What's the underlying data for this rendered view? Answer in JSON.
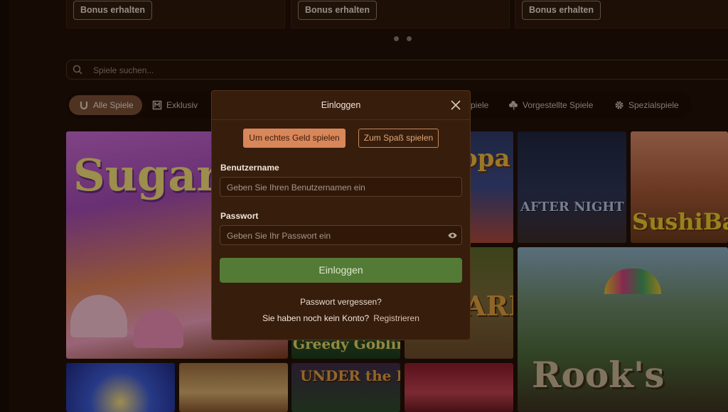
{
  "promo": {
    "bonus_label_1": "Bonus erhalten",
    "bonus_label_2": "Bonus erhalten",
    "bonus_label_3": "Bonus erhalten"
  },
  "search": {
    "placeholder": "Spiele suchen..."
  },
  "filters": {
    "all": "Alle Spiele",
    "exclusive": "Exklusiv",
    "popular_partial": "piele",
    "featured": "Vorgestellte Spiele",
    "special": "Spezialspiele"
  },
  "games": {
    "sugar_pop": "SugarPo",
    "after_night_falls": "AFTER NIGHT FALLS",
    "sushi_bar": "SushiBa",
    "greedy_goblins": "Greedy Goblins",
    "under_the_bed": "UNDER the BED",
    "rooks_revenge": "Rook's",
    "opa_partial": "opa",
    "safari_partial": "ARI"
  },
  "modal": {
    "title": "Einloggen",
    "tab_real_money": "Um echtes Geld spielen",
    "tab_fun": "Zum Spaß spielen",
    "username_label": "Benutzername",
    "username_placeholder": "Geben Sie Ihren Benutzernamen ein",
    "password_label": "Passwort",
    "password_placeholder": "Geben Sie Ihr Passwort ein",
    "submit_label": "Einloggen",
    "forgot_password": "Passwort vergessen?",
    "no_account_text": "Sie haben noch kein Konto?",
    "register_link": "Registrieren"
  },
  "colors": {
    "background": "#1c0d05",
    "modal_bg": "#371d0c",
    "accent_orange": "#d8875a",
    "submit_green": "#547b36"
  },
  "icons": [
    "search-icon",
    "horseshoe-icon",
    "exclusive-icon",
    "clover-icon",
    "gear-icon",
    "close-icon",
    "eye-icon"
  ]
}
